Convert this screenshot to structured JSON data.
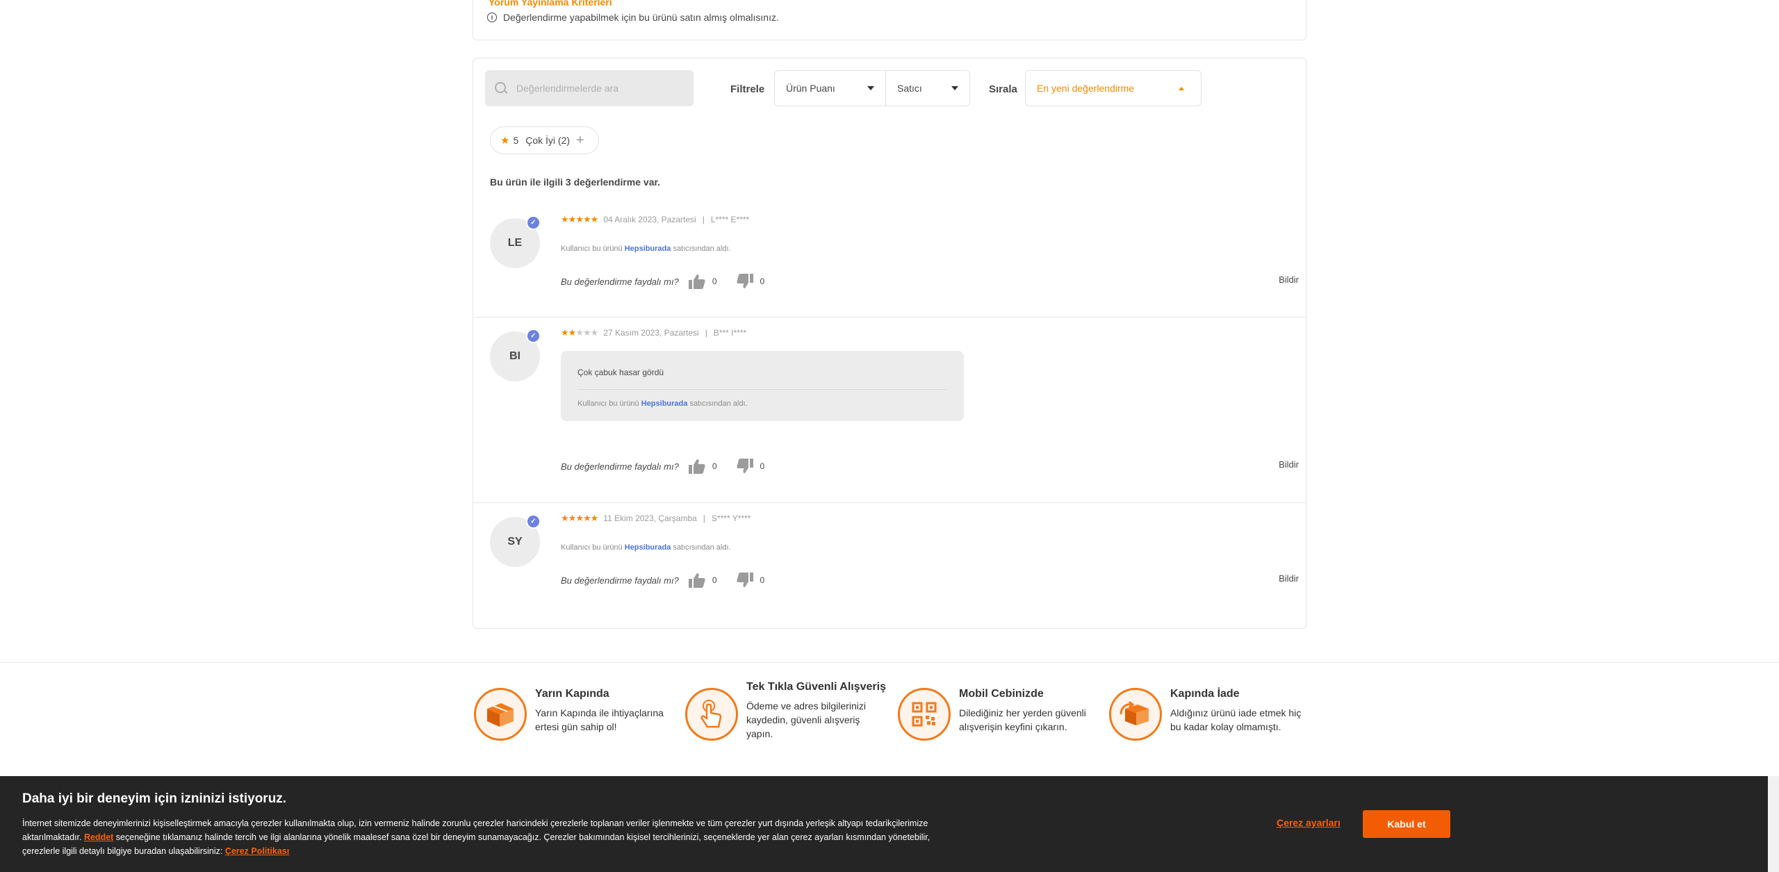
{
  "criteria": {
    "title": "Yorum Yayınlama Kriterleri",
    "note": "Değerlendirme yapabilmek için bu ürünü satın almış olmalısınız."
  },
  "toolbar": {
    "search_placeholder": "Değerlendirmelerde ara",
    "filter_label": "Filtrele",
    "filter_rating": "Ürün Puanı",
    "filter_seller": "Satıcı",
    "sort_label": "Sırala",
    "sort_value": "En yeni değerlendirme"
  },
  "chip": {
    "stars": "5",
    "label": "Çok İyi (2)"
  },
  "summary": "Bu ürün ile ilgili 3 değerlendirme var.",
  "helpful_question": "Bu değerlendirme faydalı mı?",
  "report_label": "Bildir",
  "bought_prefix": "Kullanıcı bu ürünü",
  "bought_shop": "Hepsiburada",
  "bought_suffix": "satıcısından aldı.",
  "reviews": [
    {
      "initials": "LE",
      "rating": 5,
      "date": "04 Aralık 2023, Pazartesi",
      "author": "L**** E****",
      "comment": "",
      "likes": "0",
      "dislikes": "0"
    },
    {
      "initials": "BI",
      "rating": 2,
      "date": "27 Kasım 2023, Pazartesi",
      "author": "B*** I****",
      "comment": "Çok çabuk hasar gördü",
      "likes": "0",
      "dislikes": "0"
    },
    {
      "initials": "SY",
      "rating": 5,
      "date": "11 Ekim 2023, Çarşamba",
      "author": "S**** Y****",
      "comment": "",
      "likes": "0",
      "dislikes": "0"
    }
  ],
  "features": [
    {
      "title": "Yarın Kapında",
      "desc": "Yarın Kapında ile ihtiyaçlarına ertesi gün sahip ol!",
      "icon": "delivery-box-icon"
    },
    {
      "title": "Tek Tıkla Güvenli Alışveriş",
      "desc": "Ödeme ve adres bilgilerinizi kaydedin, güvenli alışveriş yapın.",
      "icon": "hand-tap-icon"
    },
    {
      "title": "Mobil Cebinizde",
      "desc": "Dilediğiniz her yerden güvenli alışverişin keyfini çıkarın.",
      "icon": "qr-code-icon"
    },
    {
      "title": "Kapında İade",
      "desc": "Aldığınız ürünü iade etmek hiç bu kadar kolay olmamıştı.",
      "icon": "return-box-icon"
    }
  ],
  "cookie": {
    "title": "Daha iyi bir deneyim için izninizi istiyoruz.",
    "text_1": "İnternet sitemizde deneyimlerinizi kişiselleştirmek amacıyla çerezler kullanılmakta olup, izin vermeniz halinde zorunlu çerezler haricindeki çerezlerle toplanan veriler işlenmekte ve tüm çerezler yurt dışında yerleşik altyapı tedarikçilerimize aktarılmaktadır.",
    "reject_link": "Reddet",
    "text_2": "seçeneğine tıklamanız halinde tercih ve ilgi alanlarına yönelik maalesef sana özel bir deneyim sunamayacağız. Çerezler bakımından kişisel tercihlerinizi, seçeneklerde yer alan çerez ayarları kısmından yönetebilir, çerezlerle ilgili detaylı bilgiye buradan ulaşabilirsiniz:",
    "policy_link": "Çerez Politikası",
    "settings": "Çerez ayarları",
    "accept": "Kabul et"
  },
  "colors": {
    "accent": "#f28b00",
    "brand_orange": "#f25c05",
    "verified": "#6b82e0",
    "link_blue": "#4d74d6"
  }
}
